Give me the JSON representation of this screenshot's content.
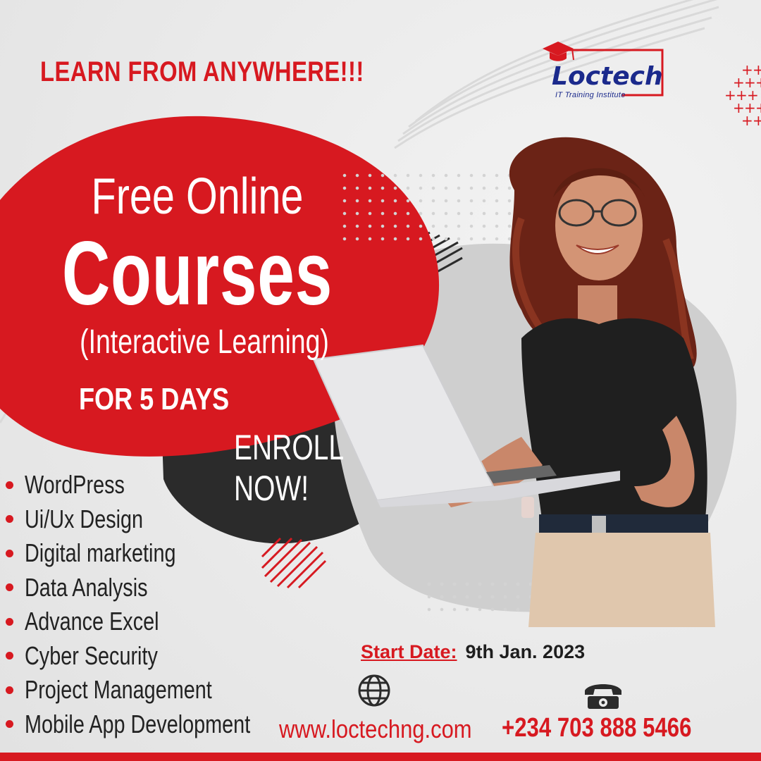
{
  "headline": "LEARN FROM ANYWHERE!!!",
  "logo": {
    "name": "Loctech",
    "tagline": "IT Training Institute"
  },
  "hero": {
    "line1": "Free Online",
    "line2": "Courses",
    "line3": "(Interactive Learning)",
    "duration": "FOR 5 DAYS"
  },
  "cta": {
    "line1": "ENROLL",
    "line2": "NOW!"
  },
  "courses": [
    "WordPress",
    "Ui/Ux Design",
    "Digital marketing",
    "Data Analysis",
    "Advance Excel",
    "Cyber Security",
    "Project Management",
    "Mobile App Development"
  ],
  "start_date": {
    "label": "Start Date:",
    "value": "9th Jan. 2023"
  },
  "contact": {
    "website": "www.loctechng.com",
    "phone": "+234 703 888 5466"
  },
  "icons": {
    "website": "globe-icon",
    "phone": "telephone-icon",
    "logo": "graduation-cap-icon"
  },
  "colors": {
    "accent": "#d71920",
    "dark": "#2b2b2b",
    "brand": "#1b2a8c",
    "background": "#ececec"
  }
}
